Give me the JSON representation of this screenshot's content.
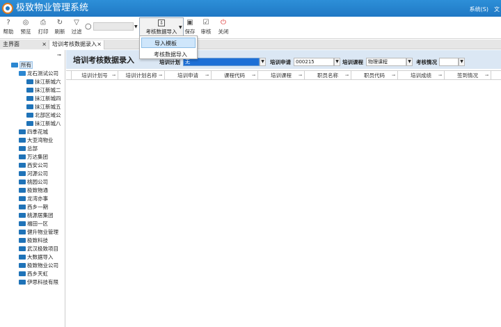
{
  "app": {
    "title": "极致物业管理系统",
    "system_menu": "系统(S)",
    "extra_menu": "文"
  },
  "toolbar": {
    "help": "帮助",
    "preview": "预览",
    "print": "打印",
    "refresh": "刷新",
    "filter": "过滤",
    "import_data": "考核数据导入",
    "save": "保存",
    "audit": "审核",
    "close": "关闭"
  },
  "dropdown": {
    "items": [
      "导入模板",
      "考核数据导入"
    ]
  },
  "tabs": [
    "主界面",
    "培训考核数据录入"
  ],
  "tree": {
    "root": "所有",
    "items": [
      "龙石测试公司",
      "抹江新城六",
      "抹江新城二",
      "抹江新城四",
      "抹江新城五",
      "北部区域公",
      "抹江新城八",
      "四季花城",
      "大亚湾物业",
      "总部",
      "万达集团",
      "西安公司",
      "河源公司",
      "桃园公司",
      "极致物通",
      "龙湾亦事",
      "西乡一期",
      "桃源居集团",
      "福田一区",
      "健升物业管理",
      "极致科技",
      "武汉极致项目",
      "大数据导入",
      "极致物业公司",
      "西乡天虹",
      "伊思科技有限"
    ]
  },
  "page": {
    "title": "培训考核数据录入",
    "filters": {
      "plan_label": "培训计划",
      "plan_value": "无",
      "apply_label": "培训申请",
      "apply_value": "000215",
      "course_label": "培训课程",
      "course_value": "物理课程",
      "assess_label": "考核情况",
      "assess_value": ""
    }
  },
  "grid": {
    "columns": [
      "培训计划号",
      "培训计划名称",
      "培训申请",
      "课程代码",
      "培训课程",
      "职员名称",
      "职员代码",
      "培训成绩",
      "签到情况"
    ]
  }
}
